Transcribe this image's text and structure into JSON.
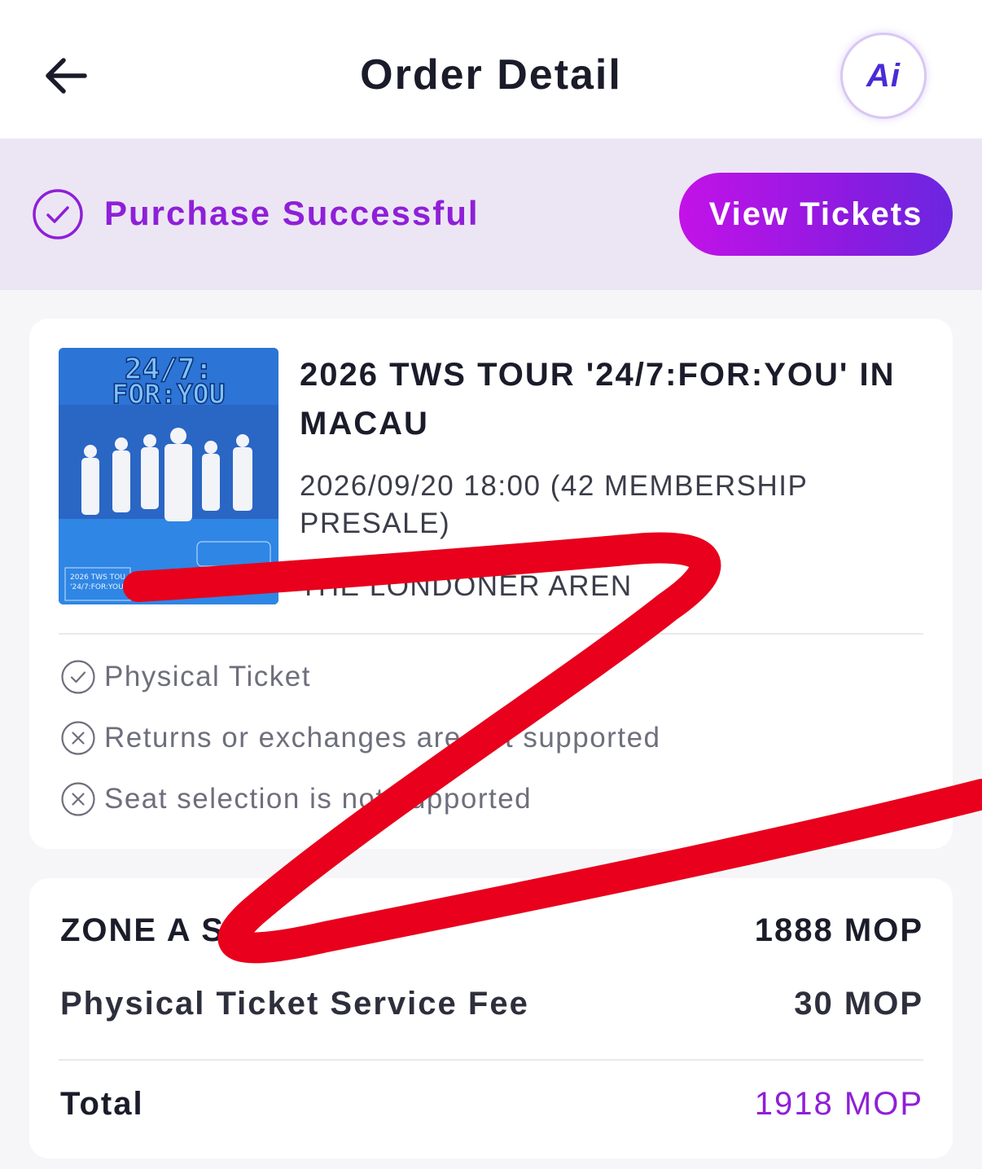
{
  "header": {
    "title": "Order Detail",
    "ai_label": "Ai"
  },
  "status": {
    "text": "Purchase Successful",
    "button_label": "View Tickets"
  },
  "event": {
    "poster": {
      "line1": "24/7:",
      "line2": "FOR:YOU",
      "caption1": "2026 TWS TOU",
      "caption2": "'24/7:FOR:YOU'"
    },
    "title": "2026 TWS TOUR '24/7:FOR:YOU' IN MACAU",
    "datetime": "2026/09/20 18:00  (42 MEMBERSHIP PRESALE)",
    "venue": "THE LONDONER AREN"
  },
  "features": [
    {
      "icon": "check-circle-icon",
      "text": "Physical Ticket"
    },
    {
      "icon": "x-circle-icon",
      "text": "Returns or exchanges are not supported"
    },
    {
      "icon": "x-circle-icon",
      "text": "Seat selection is not supported"
    }
  ],
  "pricing": {
    "zone_label": "ZONE A S",
    "zone_price": "1888 MOP",
    "fee_label": "Physical Ticket Service Fee",
    "fee_price": "30 MOP",
    "total_label": "Total",
    "total_price": "1918 MOP"
  },
  "colors": {
    "accent": "#8f1fd8",
    "band": "#ece6f4",
    "scribble": "#e8001c"
  }
}
